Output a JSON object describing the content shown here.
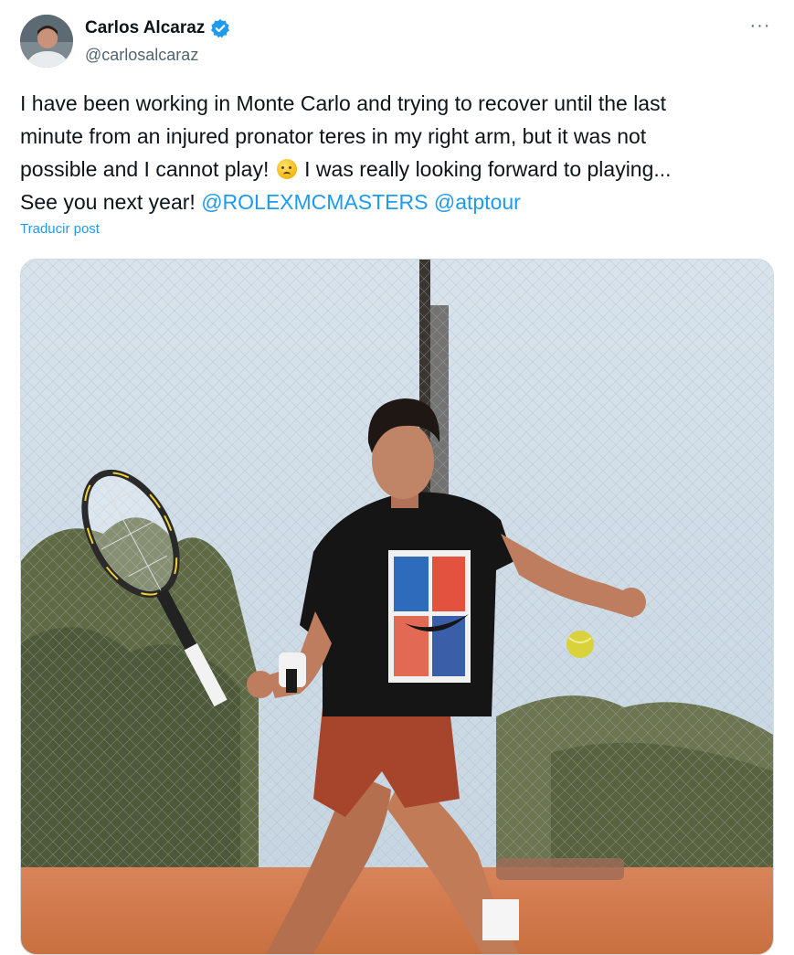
{
  "author": {
    "display_name": "Carlos Alcaraz",
    "handle": "@carlosalcaraz",
    "verified": true
  },
  "tweet": {
    "lines": [
      "I have been working in Monte Carlo and trying to recover until the last",
      "minute from an injured pronator teres in my right arm, but it was not",
      "possible and I cannot play!",
      " I was really looking forward to playing...",
      "See you next year! ",
      "@ROLEXMCMASTERS",
      "@atptour"
    ],
    "mentions": [
      "@ROLEXMCMASTERS",
      "@atptour"
    ],
    "translate_label": "Traducir post"
  },
  "more_label": "···",
  "icons": {
    "verified": "verified-badge-icon",
    "more": "more-options-icon",
    "emoji": "crying-face-emoji"
  },
  "colors": {
    "link": "#1d9bf0",
    "text": "#0f1419",
    "secondary": "#536471"
  }
}
